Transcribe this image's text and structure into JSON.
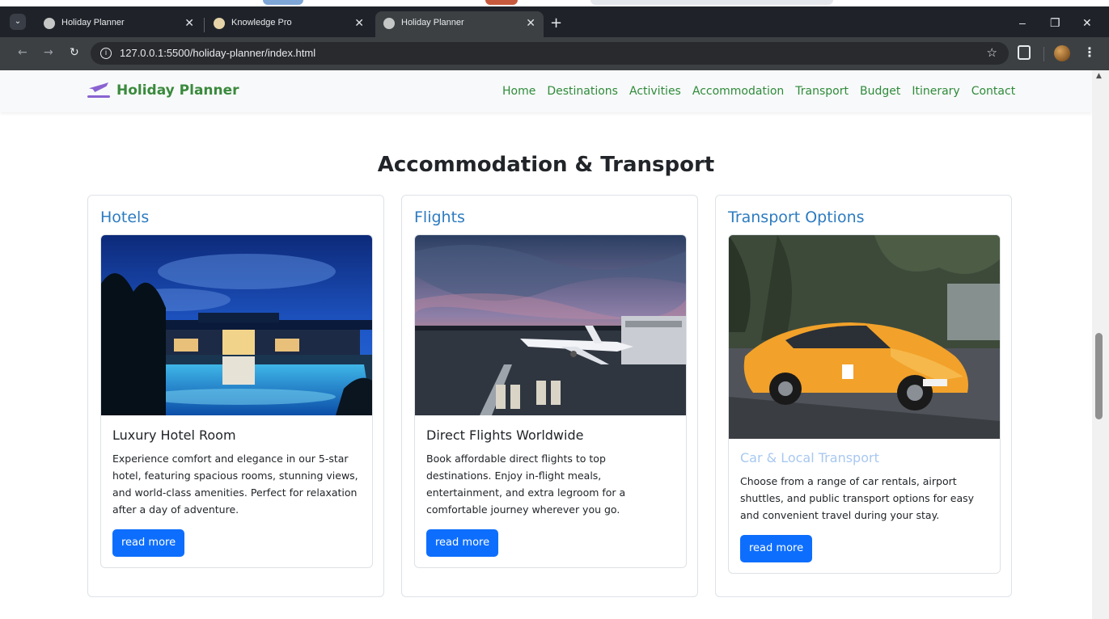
{
  "browser": {
    "tabs": [
      {
        "title": "Holiday Planner",
        "active": false
      },
      {
        "title": "Knowledge Pro",
        "active": false
      },
      {
        "title": "Holiday Planner",
        "active": true
      }
    ],
    "url": "127.0.0.1:5500/holiday-planner/index.html"
  },
  "navbar": {
    "brand": "Holiday Planner",
    "links": [
      "Home",
      "Destinations",
      "Activities",
      "Accommodation",
      "Transport",
      "Budget",
      "Itinerary",
      "Contact"
    ]
  },
  "section": {
    "title": "Accommodation & Transport"
  },
  "cards": [
    {
      "heading": "Hotels",
      "item_title": "Luxury Hotel Room",
      "text": "Experience comfort and elegance in our 5-star hotel, featuring spacious rooms, stunning views, and world-class amenities. Perfect for relaxation after a day of adventure.",
      "button": "read more"
    },
    {
      "heading": "Flights",
      "item_title": "Direct Flights Worldwide",
      "text": "Book affordable direct flights to top destinations. Enjoy in-flight meals, entertainment, and extra legroom for a comfortable journey wherever you go.",
      "button": "read more"
    },
    {
      "heading": "Transport Options",
      "item_title": "Car & Local Transport",
      "text": "Choose from a range of car rentals, airport shuttles, and public transport options for easy and convenient travel during your stay.",
      "button": "read more"
    }
  ],
  "colors": {
    "brand_green": "#3a8a3d",
    "card_heading_blue": "#2c7bc0",
    "button_blue": "#0d6efd",
    "chrome_dark": "#1f2329"
  }
}
